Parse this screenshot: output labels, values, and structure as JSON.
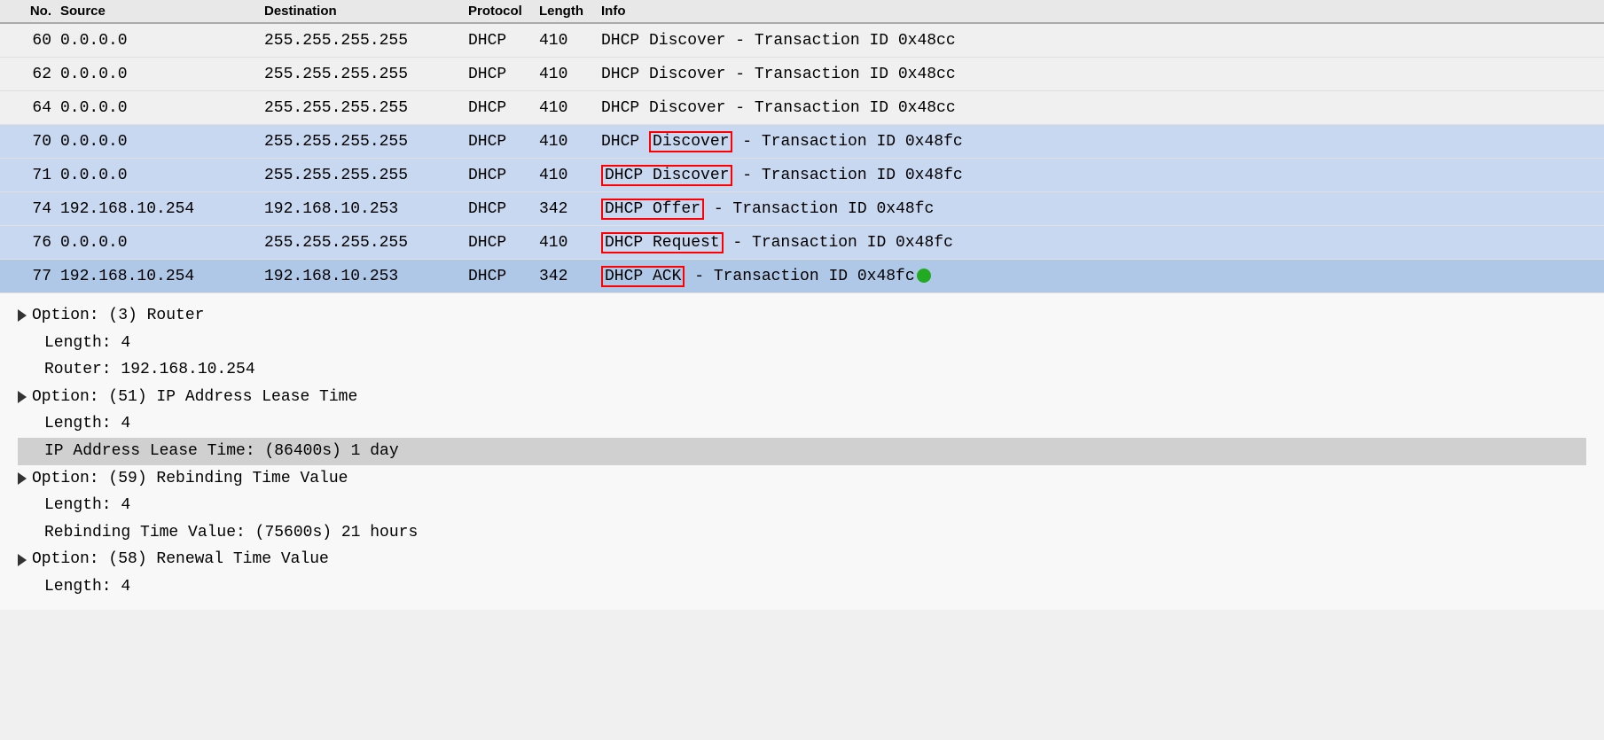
{
  "header": {
    "no": "No.",
    "source": "Source",
    "destination": "Destination",
    "protocol": "Protocol",
    "length": "Length",
    "info": "Info"
  },
  "packets": [
    {
      "no": "60",
      "source": "0.0.0.0",
      "destination": "255.255.255.255",
      "protocol": "DHCP",
      "length": "410",
      "info": "DHCP Discover - Transaction ID 0x48cc",
      "highlighted": false,
      "selected": false,
      "redbox_info": false
    },
    {
      "no": "62",
      "source": "0.0.0.0",
      "destination": "255.255.255.255",
      "protocol": "DHCP",
      "length": "410",
      "info": "DHCP Discover - Transaction ID 0x48cc",
      "highlighted": false,
      "selected": false,
      "redbox_info": false
    },
    {
      "no": "64",
      "source": "0.0.0.0",
      "destination": "255.255.255.255",
      "protocol": "DHCP",
      "length": "410",
      "info": "DHCP Discover - Transaction ID 0x48cc",
      "highlighted": false,
      "selected": false,
      "redbox_info": false
    },
    {
      "no": "70",
      "source": "0.0.0.0",
      "destination": "255.255.255.255",
      "protocol": "DHCP",
      "length": "410",
      "info_prefix": "DHCP Discover",
      "info_suffix": " - Transaction ID 0x48fc",
      "highlighted": true,
      "selected": false,
      "redbox_info": false,
      "partial_redbox": true
    },
    {
      "no": "71",
      "source": "0.0.0.0",
      "destination": "255.255.255.255",
      "protocol": "DHCP",
      "length": "410",
      "info_prefix": "DHCP Discover",
      "info_suffix": " - Transaction ID 0x48fc",
      "highlighted": true,
      "selected": false,
      "redbox_info": true,
      "partial_redbox": false
    },
    {
      "no": "74",
      "source": "192.168.10.254",
      "destination": "192.168.10.253",
      "protocol": "DHCP",
      "length": "342",
      "info_prefix": "DHCP Offer",
      "info_suffix": " - Transaction ID 0x48fc",
      "highlighted": true,
      "selected": false,
      "redbox_info": true,
      "bracket_left": true
    },
    {
      "no": "76",
      "source": "0.0.0.0",
      "destination": "255.255.255.255",
      "protocol": "DHCP",
      "length": "410",
      "info_prefix": "DHCP Request",
      "info_suffix": " - Transaction ID 0x48fc",
      "highlighted": true,
      "selected": false,
      "redbox_info": true,
      "bracket_left": true
    },
    {
      "no": "77",
      "source": "192.168.10.254",
      "destination": "192.168.10.253",
      "protocol": "DHCP",
      "length": "342",
      "info_prefix": "DHCP ACK",
      "info_suffix": " - Transaction ID 0x48fc",
      "highlighted": true,
      "selected": true,
      "redbox_info": true,
      "bracket_left": true,
      "has_cursor": true
    }
  ],
  "detail": {
    "sections": [
      {
        "id": "router",
        "header": "Option: (3) Router",
        "fields": [
          {
            "label": "Length: 4"
          },
          {
            "label": "Router: 192.168.10.254"
          }
        ]
      },
      {
        "id": "lease_time",
        "header": "Option: (51) IP Address Lease Time",
        "fields": [
          {
            "label": "Length: 4"
          },
          {
            "label": "IP Address Lease Time: (86400s) 1 day",
            "highlight": true
          }
        ]
      },
      {
        "id": "rebinding",
        "header": "Option: (59) Rebinding Time Value",
        "fields": [
          {
            "label": "Length: 4"
          },
          {
            "label": "Rebinding Time Value: (75600s) 21 hours"
          }
        ]
      },
      {
        "id": "renewal",
        "header": "Option: (58) Renewal Time Value",
        "fields": [
          {
            "label": "Length: 4"
          }
        ]
      }
    ]
  }
}
